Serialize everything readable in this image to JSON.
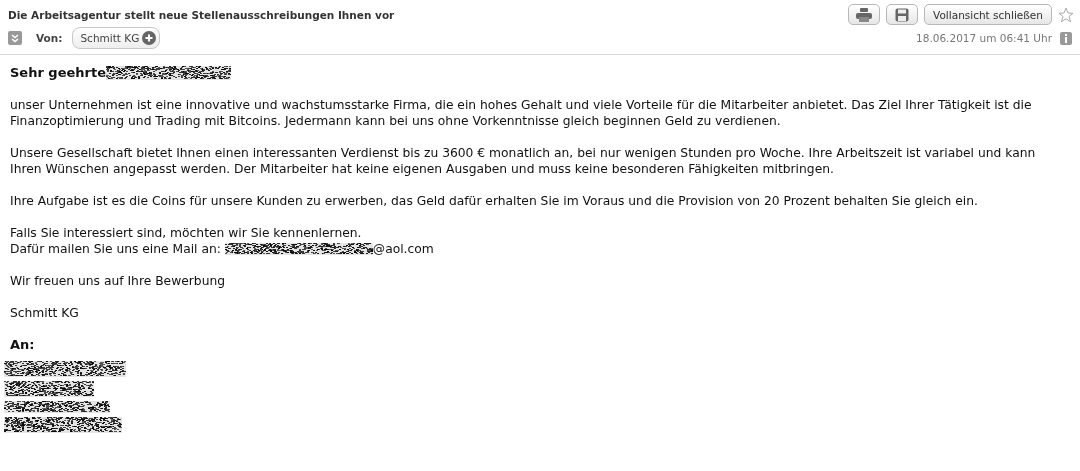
{
  "header": {
    "subject": "Die Arbeitsagentur stellt neue Stellenausschreibungen Ihnen vor",
    "from_label": "Von:",
    "sender": "Schmitt KG",
    "date": "18.06.2017 um 06:41 Uhr",
    "close_button": "Vollansicht schließen",
    "starred": false
  },
  "greeting": {
    "text": "Sehr geehrte",
    "redacted": true
  },
  "paragraphs": [
    [
      {
        "text": "unser Unternehmen ist eine innovative und wachstumsstarke Firma, die ein hohes Gehalt und viele Vorteile für die Mitarbeiter anbietet. Das Ziel Ihrer Tätigkeit ist die Finanzoptimierung und Trading mit Bitcoins. Jedermann kann bei uns ohne Vorkenntnisse gleich beginnen Geld zu verdienen."
      }
    ],
    [
      {
        "text": "Unsere Gesellschaft bietet Ihnen einen interessanten Verdienst bis zu 3600 € monatlich an, bei nur wenigen Stunden pro Woche. Ihre Arbeitszeit ist variabel und kann Ihren Wünschen angepasst werden. Der Mitarbeiter hat keine eigenen Ausgaben und muss keine besonderen Fähigkeiten mitbringen."
      }
    ],
    [
      {
        "text": "Ihre Aufgabe ist es die Coins für unsere Kunden zu erwerben, das Geld dafür erhalten Sie im Voraus und die Provision von 20 Prozent behalten Sie gleich ein."
      }
    ],
    [
      {
        "text": "Falls Sie interessiert sind, möchten wir Sie kennenlernen."
      },
      {
        "text": "Dafür mailen Sie uns eine Mail an:",
        "redacted": true,
        "after": "@aol.com"
      }
    ],
    [
      {
        "text": "Wir freuen uns auf Ihre Bewerbung"
      }
    ],
    [
      {
        "text": "Schmitt KG"
      }
    ]
  ],
  "recipients": {
    "label": "An:",
    "entries": [
      {
        "redacted": true
      },
      {
        "redacted": true
      },
      {
        "redacted": true
      },
      {
        "redacted": true
      }
    ]
  }
}
